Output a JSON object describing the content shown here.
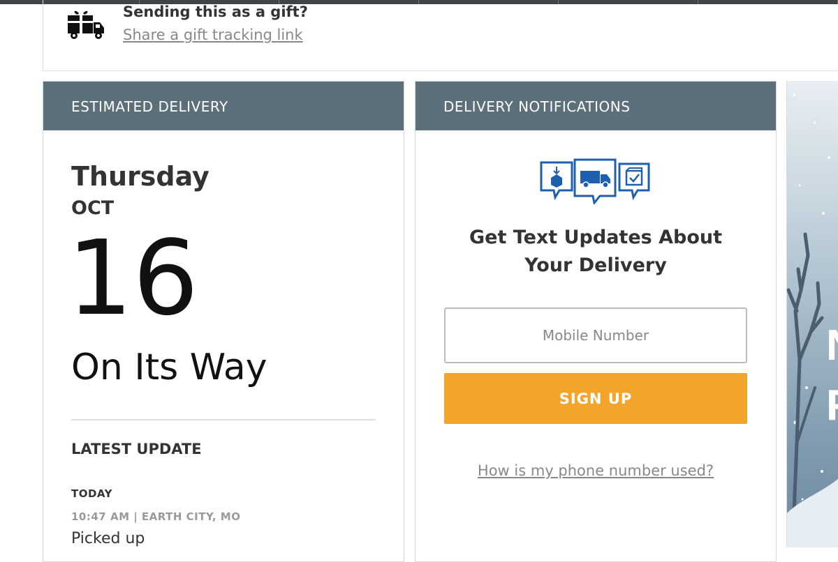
{
  "gift": {
    "title": "Sending this as a gift?",
    "link": "Share a gift tracking link",
    "icon": "gift-truck-icon"
  },
  "estimated": {
    "header": "ESTIMATED DELIVERY",
    "weekday": "Thursday",
    "month": "OCT",
    "day": "16",
    "status": "On Its Way",
    "latest_label": "LATEST UPDATE",
    "update_day": "TODAY",
    "update_meta": "10:47 AM | EARTH CITY, MO",
    "update_event": "Picked up"
  },
  "notifications": {
    "header": "DELIVERY NOTIFICATIONS",
    "icon": "delivery-notification-icons",
    "heading_line1": "Get Text Updates About",
    "heading_line2": "Your Delivery",
    "mobile_placeholder": "Mobile Number",
    "signup_label": "SIGN UP",
    "phone_link": "How is my phone number used?"
  },
  "colors": {
    "header_bg": "#5c707c",
    "signup_bg": "#f2a52a",
    "icon_blue": "#1f5fb0"
  }
}
